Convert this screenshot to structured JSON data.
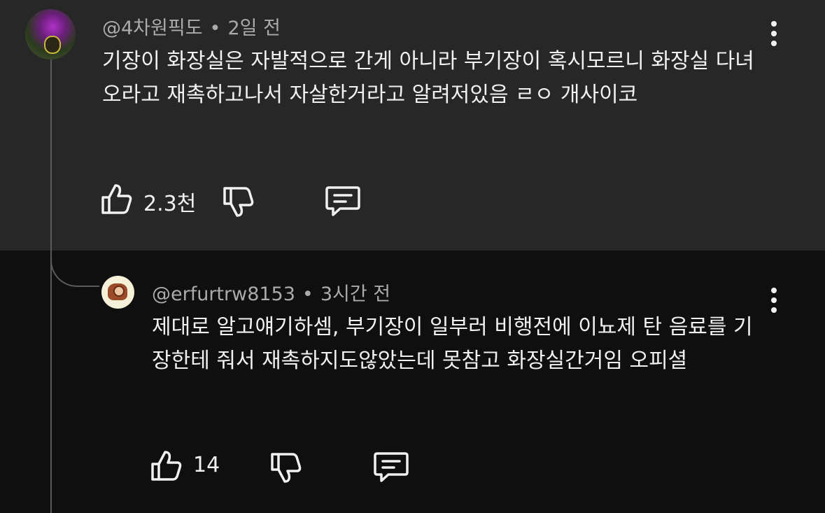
{
  "comments": [
    {
      "author": "@4차원픽도",
      "separator": "•",
      "time": "2일 전",
      "text": "기장이 화장실은 자발적으로 간게 아니라 부기장이 혹시모르니 화장실 다녀오라고 재촉하고나서 자살한거라고 알려저있음 ㄹㅇ 개사이코",
      "likes": "2.3천",
      "icons": [
        "like-icon",
        "dislike-icon",
        "reply-icon",
        "more-options-icon"
      ]
    },
    {
      "author": "@erfurtrw8153",
      "separator": "•",
      "time": "3시간 전",
      "text": "제대로 알고얘기하셈, 부기장이 일부러 비행전에 이뇨제 탄 음료를 기장한테 줘서 재촉하지도않았는데 못참고 화장실간거임 오피셜",
      "likes": "14",
      "icons": [
        "like-icon",
        "dislike-icon",
        "reply-icon",
        "more-options-icon"
      ]
    }
  ],
  "colors": {
    "top_comment_bg": "#272727",
    "reply_bg": "#0f0f0f",
    "text": "#f1f1f1",
    "meta": "#aaaaaa"
  }
}
